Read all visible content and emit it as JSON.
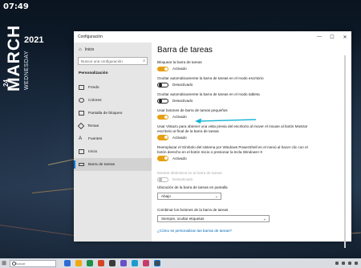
{
  "desktop": {
    "clock": "07:49",
    "year": "2021",
    "month": "MARCH",
    "day": "24",
    "weekday": "WEDNESDAY"
  },
  "window": {
    "title": "Configuración",
    "controls": {
      "minimize": "—",
      "maximize": "☐",
      "close": "✕"
    }
  },
  "sidebar": {
    "home": "Inicio",
    "search_placeholder": "Buscar una configuración",
    "section_heading": "Personalización",
    "items": [
      {
        "label": "Fondo",
        "icon": "image-icon",
        "active": false
      },
      {
        "label": "Colores",
        "icon": "palette-icon",
        "active": false
      },
      {
        "label": "Pantalla de bloqueo",
        "icon": "lock-screen-icon",
        "active": false
      },
      {
        "label": "Temas",
        "icon": "brush-icon",
        "active": false
      },
      {
        "label": "Fuentes",
        "icon": "font-icon",
        "active": false
      },
      {
        "label": "Inicio",
        "icon": "start-icon",
        "active": false
      },
      {
        "label": "Barra de tareas",
        "icon": "taskbar-icon",
        "active": true
      }
    ]
  },
  "main": {
    "title": "Barra de tareas",
    "settings": [
      {
        "label": "Bloquear la barra de tareas",
        "state": "Activado",
        "on": true
      },
      {
        "label": "Ocultar automáticamente la barra de tareas en el modo escritorio",
        "state": "Desactivado",
        "on": false
      },
      {
        "label": "Ocultar automáticamente la barra de tareas en el modo tableta",
        "state": "Desactivado",
        "on": false
      },
      {
        "label": "Usar botones de barra de tareas pequeños",
        "state": "Activado",
        "on": true
      },
      {
        "label": "Usar Vistazo para obtener una vista previa del escritorio al mover el mouse al botón Mostrar escritorio al final de la barra de tareas",
        "state": "Activado",
        "on": true
      },
      {
        "label": "Reemplazar el Símbolo del sistema por Windows PowerShell en el menú al hacer clic con el botón derecho en el botón Inicio o presionar la tecla Windows+X",
        "state": "Activado",
        "on": true
      },
      {
        "label": "Mostrar distintivos en la barra de tareas",
        "state": "Desactivado",
        "on": false,
        "disabled": true
      }
    ],
    "location": {
      "label": "Ubicación de la barra de tareas en pantalla",
      "value": "Abajo"
    },
    "combine": {
      "label": "Combinar los botones de la barra de tareas",
      "value": "Siempre, ocultar etiquetas"
    },
    "help_link": "¿Cómo se personalizan las barras de tareas?"
  },
  "taskbar": {
    "search_placeholder": "Buscar",
    "app_colors": [
      "#2b6cd6",
      "#f0a814",
      "#1e8f4a",
      "#d64527",
      "#3a3a3a",
      "#6a4fc7",
      "#1d9bd1",
      "#c73b6c"
    ]
  },
  "colors": {
    "accent": "#0078d7",
    "toggle_on": "#e6a012",
    "annotation_arrow": "#18b6d6"
  }
}
